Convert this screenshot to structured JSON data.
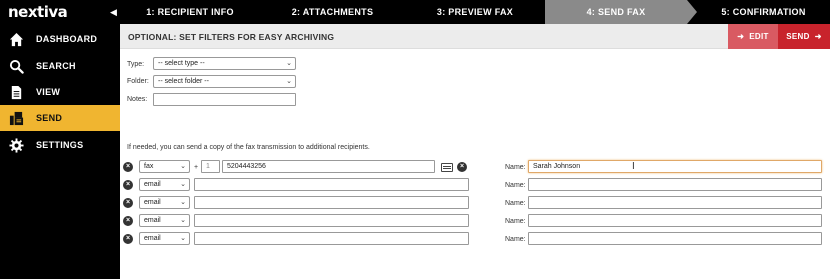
{
  "app": {
    "logo": "nextiva"
  },
  "sidebar": {
    "items": [
      {
        "label": "DASHBOARD",
        "icon": "home-icon",
        "active": false
      },
      {
        "label": "SEARCH",
        "icon": "search-icon",
        "active": false
      },
      {
        "label": "VIEW",
        "icon": "document-icon",
        "active": false
      },
      {
        "label": "SEND",
        "icon": "send-fax-icon",
        "active": true
      },
      {
        "label": "SETTINGS",
        "icon": "gear-icon",
        "active": false
      }
    ]
  },
  "steps": [
    {
      "label": "1: RECIPIENT INFO",
      "active": false
    },
    {
      "label": "2: ATTACHMENTS",
      "active": false
    },
    {
      "label": "3: PREVIEW FAX",
      "active": false
    },
    {
      "label": "4: SEND FAX",
      "active": true
    },
    {
      "label": "5: CONFIRMATION",
      "active": false
    }
  ],
  "subheader": {
    "title": "OPTIONAL: SET FILTERS FOR EASY ARCHIVING",
    "edit_label": "EDIT",
    "send_label": "SEND"
  },
  "filters": {
    "type_label": "Type:",
    "type_value": "-- select type --",
    "folder_label": "Folder:",
    "folder_value": "-- select folder --",
    "notes_label": "Notes:",
    "notes_value": ""
  },
  "copy_info": "If needed, you can send a copy of the fax transmission to additional recipients.",
  "recipients": [
    {
      "method": "fax",
      "prefix": "+",
      "country": "1",
      "number": "5204443256",
      "name_label": "Name:",
      "name": "Sarah Johnson"
    },
    {
      "method": "email",
      "address": "",
      "name_label": "Name:",
      "name": ""
    },
    {
      "method": "email",
      "address": "",
      "name_label": "Name:",
      "name": ""
    },
    {
      "method": "email",
      "address": "",
      "name_label": "Name:",
      "name": ""
    },
    {
      "method": "email",
      "address": "",
      "name_label": "Name:",
      "name": ""
    }
  ],
  "colors": {
    "sidebar_bg": "#000000",
    "active_nav": "#f0b530",
    "active_step": "#8a8a8a",
    "edit_button": "#d95a62",
    "send_button": "#c8232c"
  }
}
